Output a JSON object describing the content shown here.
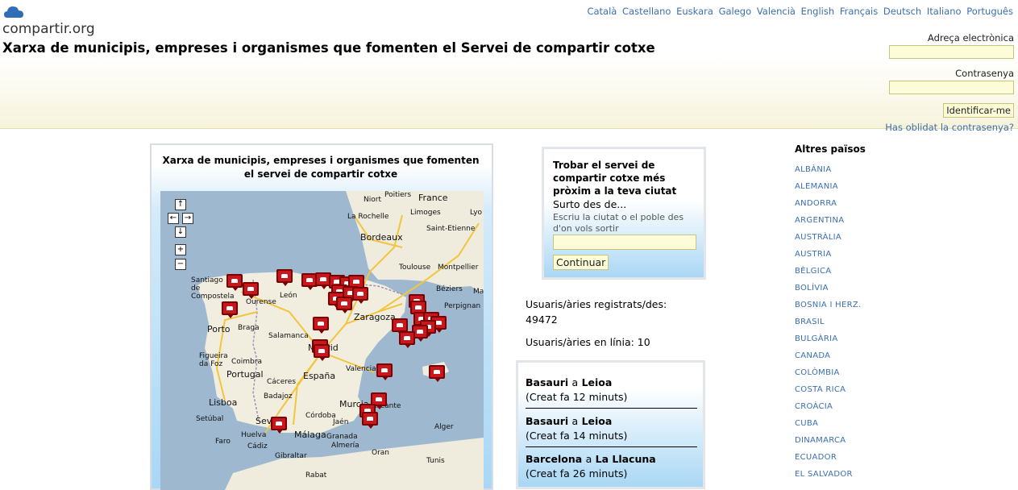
{
  "logo": {
    "name": "compartir.org",
    "icon": "cloud-icon"
  },
  "languages": [
    "Català",
    "Castellano",
    "Euskara",
    "Galego",
    "Valencià",
    "English",
    "Français",
    "Deutsch",
    "Italiano",
    "Português"
  ],
  "page_title": "Xarxa de municipis, empreses i organismes que fomenten el Servei de compartir cotxe",
  "login": {
    "email_label": "Adreça electrònica",
    "password_label": "Contrasenya",
    "submit_label": "Identificar-me",
    "forgot_label": "Has oblidat la contrasenya?"
  },
  "map_panel": {
    "title": "Xarxa de municipis, empreses i organismes que fomenten el servei de compartir cotxe",
    "controls": {
      "up": "↑",
      "left": "←",
      "right": "→",
      "down": "↓",
      "zoom_in": "+",
      "zoom_out": "−"
    },
    "labels": {
      "france": "France",
      "niort": "Niort",
      "poitiers": "Poitiers",
      "limoges": "Limoges",
      "larochelle": "La Rochelle",
      "lyo": "Lyo",
      "saintetienne": "Saint-Etienne",
      "bordeaux": "Bordeaux",
      "toulouse": "Toulouse",
      "montpellier": "Montpellier",
      "beziers": "Béziers",
      "perpignan": "Perpignan",
      "santiago": "Santiago de Compostela",
      "leon": "León",
      "ourense": "Ourense",
      "porto": "Porto",
      "braga": "Braga",
      "zaragoza": "Zaragoza",
      "salamanca": "Salamanca",
      "madrid": "Madrid",
      "espana": "España",
      "portugal": "Portugal",
      "valencia": "Valencia",
      "figueira": "Figueira da Foz",
      "coimbra": "Coimbra",
      "lisboa": "Lisboa",
      "badajoz": "Badajoz",
      "caceres": "Cáceres",
      "cordoba": "Córdoba",
      "sevilla": "Sevilla",
      "malaga": "Málaga",
      "granada": "Granada",
      "almeria": "Almería",
      "murcia": "Murcia",
      "alicante": "Alicante",
      "cadiz": "Cádiz",
      "gibraltar": "Gibraltar",
      "alger": "Alger",
      "tunis": "Tunis",
      "rabat": "Rabat",
      "oran": "Oran",
      "setubal": "Setúbal",
      "faro": "Faro",
      "huelva": "Huelva",
      "jaen": "Jaén",
      "mar": "Ma"
    }
  },
  "search": {
    "title": "Trobar el servei de compartir cotxe més pròxim a la teva ciutat",
    "subtitle": "Surto des de...",
    "hint": "Escriu la ciutat o el poble des d'on vols sortir",
    "button_label": "Continuar"
  },
  "stats": {
    "registered_label": "Usuaris/àries registrats/des:",
    "registered_count": "49472",
    "online_text": "Usuaris/àries en línia: 10"
  },
  "trips": [
    {
      "from": "Basauri",
      "conj": "a",
      "to": "Leioa",
      "created": "(Creat fa 12 minuts)"
    },
    {
      "from": "Basauri",
      "conj": "a",
      "to": "Leioa",
      "created": "(Creat fa 14 minuts)"
    },
    {
      "from": "Barcelona",
      "conj": "a",
      "to": "La Llacuna",
      "created": "(Creat fa 26 minuts)"
    }
  ],
  "countries": {
    "heading": "Altres països",
    "items": [
      "ALBÀNIA",
      "ALEMANIA",
      "ANDORRA",
      "ARGENTINA",
      "AUSTRÀLIA",
      "AUSTRIA",
      "BÈLGICA",
      "BOLÍVIA",
      "BOSNIA I HERZ.",
      "BRASIL",
      "BULGÀRIA",
      "CANADA",
      "COLÒMBIA",
      "COSTA RICA",
      "CROÀCIA",
      "CUBA",
      "DINAMARCA",
      "ECUADOR",
      "EL SALVADOR"
    ]
  },
  "colors": {
    "link": "#3a6fb0",
    "marker": "#c8181e",
    "panel_blue": "#a9d7f5",
    "input_bg": "#fdfcd8"
  }
}
